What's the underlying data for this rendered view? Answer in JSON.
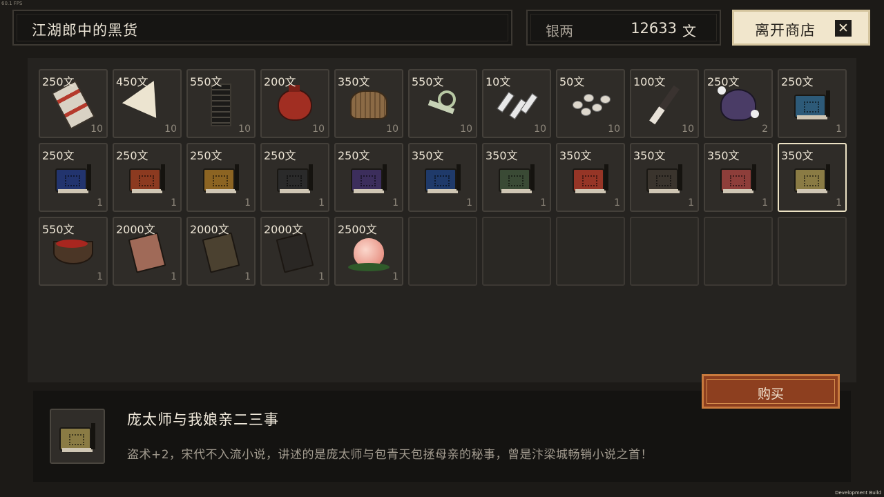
{
  "header": {
    "shop_title": "江湖郎中的黑货",
    "silver_label": "银两",
    "silver_amount": "12633",
    "silver_unit": "文",
    "leave_button_label": "离开商店",
    "leave_icon": "close-icon"
  },
  "items": [
    {
      "price": "250文",
      "qty": "10",
      "icon": "scroll",
      "color": "#b53a2c"
    },
    {
      "price": "450文",
      "qty": "10",
      "icon": "fan",
      "color": "#ece4d0"
    },
    {
      "price": "550文",
      "qty": "10",
      "icon": "tablet",
      "color": "#1b1a18"
    },
    {
      "price": "200文",
      "qty": "10",
      "icon": "pouch",
      "color": "#a12e22"
    },
    {
      "price": "350文",
      "qty": "10",
      "icon": "basket",
      "color": "#8b6a45"
    },
    {
      "price": "550文",
      "qty": "10",
      "icon": "whip",
      "color": "#c7d2b6"
    },
    {
      "price": "10文",
      "qty": "10",
      "icon": "darts",
      "color": "#e8e8e8"
    },
    {
      "price": "50文",
      "qty": "10",
      "icon": "pebbles",
      "color": "#ddd7cc"
    },
    {
      "price": "100文",
      "qty": "10",
      "icon": "brush",
      "color": "#3a3330"
    },
    {
      "price": "250文",
      "qty": "2",
      "icon": "pot",
      "color": "#4a3c66"
    },
    {
      "price": "250文",
      "qty": "1",
      "icon": "book",
      "color": "#2d5a78"
    },
    {
      "price": "250文",
      "qty": "1",
      "icon": "book",
      "color": "#22346e"
    },
    {
      "price": "250文",
      "qty": "1",
      "icon": "book",
      "color": "#8c3a20"
    },
    {
      "price": "250文",
      "qty": "1",
      "icon": "book",
      "color": "#8c6422"
    },
    {
      "price": "250文",
      "qty": "1",
      "icon": "book",
      "color": "#2a2a2a"
    },
    {
      "price": "250文",
      "qty": "1",
      "icon": "book",
      "color": "#3c2e5c"
    },
    {
      "price": "350文",
      "qty": "1",
      "icon": "book",
      "color": "#1f3a6a"
    },
    {
      "price": "350文",
      "qty": "1",
      "icon": "book",
      "color": "#3a4a35"
    },
    {
      "price": "350文",
      "qty": "1",
      "icon": "book",
      "color": "#963526"
    },
    {
      "price": "350文",
      "qty": "1",
      "icon": "book",
      "color": "#3a342d"
    },
    {
      "price": "350文",
      "qty": "1",
      "icon": "book",
      "color": "#8e3e3a"
    },
    {
      "price": "350文",
      "qty": "1",
      "icon": "book",
      "color": "#8a7b44",
      "selected": true
    },
    {
      "price": "550文",
      "qty": "1",
      "icon": "bowl",
      "color": "#a8261f"
    },
    {
      "price": "2000文",
      "qty": "1",
      "icon": "tome",
      "color": "#a06a58"
    },
    {
      "price": "2000文",
      "qty": "1",
      "icon": "tome",
      "color": "#4b4130"
    },
    {
      "price": "2000文",
      "qty": "1",
      "icon": "tome",
      "color": "#2a2724"
    },
    {
      "price": "2500文",
      "qty": "1",
      "icon": "peach",
      "color": "#e9907e"
    },
    {},
    {},
    {},
    {},
    {},
    {}
  ],
  "buy_button_label": "购买",
  "detail": {
    "name": "庞太师与我娘亲二三事",
    "description": "盗术+2，宋代不入流小说，讲述的是庞太师与包青天包拯母亲的秘事，曾是汴梁城畅销小说之首！",
    "icon": "book",
    "icon_color": "#8a7b44"
  },
  "corner_fps": "60.1 FPS",
  "dev_build": "Development Build"
}
